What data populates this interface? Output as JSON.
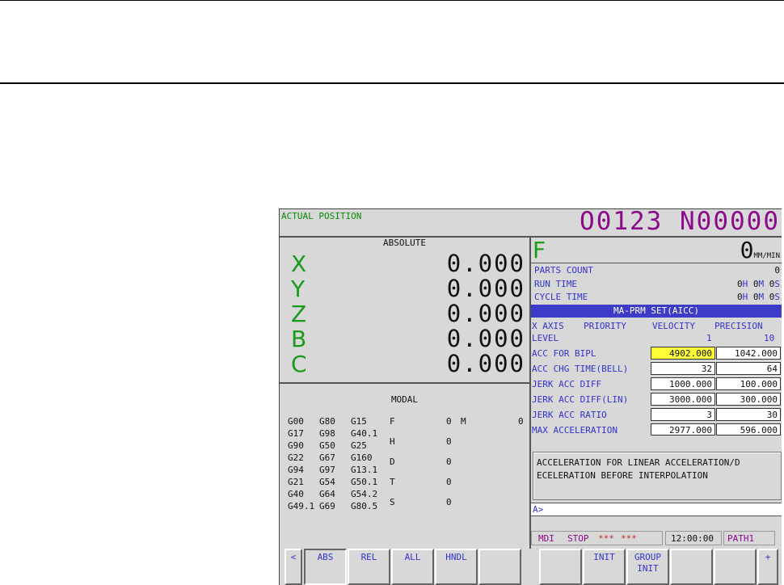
{
  "screen": {
    "title": "ACTUAL POSITION",
    "program": "O0123 N00000"
  },
  "position": {
    "header": "ABSOLUTE",
    "axes": [
      {
        "name": "X",
        "value": "0.000"
      },
      {
        "name": "Y",
        "value": "0.000"
      },
      {
        "name": "Z",
        "value": "0.000"
      },
      {
        "name": "B",
        "value": "0.000"
      },
      {
        "name": "C",
        "value": "0.000"
      }
    ]
  },
  "modal": {
    "header": "MODAL",
    "gcodes": [
      [
        "G00",
        "G80",
        "G15"
      ],
      [
        "G17",
        "G98",
        "G40.1"
      ],
      [
        "G90",
        "G50",
        "G25"
      ],
      [
        "G22",
        "G67",
        "G160"
      ],
      [
        "G94",
        "G97",
        "G13.1"
      ],
      [
        "G21",
        "G54",
        "G50.1"
      ],
      [
        "G40",
        "G64",
        "G54.2"
      ],
      [
        "G49.1",
        "G69",
        "G80.5"
      ]
    ],
    "codes": [
      {
        "label": "F",
        "value": "0"
      },
      {
        "label": "H",
        "value": "0"
      },
      {
        "label": "D",
        "value": "0"
      },
      {
        "label": "T",
        "value": "0"
      },
      {
        "label": "S",
        "value": "0"
      }
    ],
    "m_label": "M",
    "m_value": "0"
  },
  "feed": {
    "label": "F",
    "value": "0",
    "unit": "MM/MIN"
  },
  "counters": {
    "parts_count_label": "PARTS COUNT",
    "parts_count_value": "0",
    "run_time_label": "RUN TIME",
    "cycle_time_label": "CYCLE TIME",
    "time_values": [
      "0",
      "0",
      "0"
    ],
    "time_units": [
      "H",
      "M",
      "S"
    ]
  },
  "params": {
    "title": "MA-PRM SET(AICC)",
    "axis_label": "X AXIS",
    "priority_label": "PRIORITY",
    "velocity_label": "VELOCITY",
    "precision_label": "PRECISION",
    "level_label": "LEVEL",
    "level_velocity": "1",
    "level_precision": "10",
    "rows": [
      {
        "label": "ACC FOR BIPL",
        "velocity": "4902.000",
        "precision": "1042.000"
      },
      {
        "label": "ACC CHG TIME(BELL)",
        "velocity": "32",
        "precision": "64"
      },
      {
        "label": "JERK ACC DIFF",
        "velocity": "1000.000",
        "precision": "100.000"
      },
      {
        "label": "JERK ACC DIFF(LIN)",
        "velocity": "3000.000",
        "precision": "300.000"
      },
      {
        "label": "JERK ACC RATIO",
        "velocity": "3",
        "precision": "30"
      },
      {
        "label": "MAX ACCELERATION",
        "velocity": "2977.000",
        "precision": "596.000"
      }
    ],
    "help_line1": "ACCELERATION FOR LINEAR ACCELERATION/D",
    "help_line2": "ECELERATION BEFORE INTERPOLATION"
  },
  "input": {
    "prompt": "A>"
  },
  "status": {
    "mode": "MDI",
    "state": "STOP",
    "alarm1": "***",
    "alarm2": "***",
    "clock": "12:00:00",
    "path": "PATH1"
  },
  "softkeys": {
    "left_arrow": "<",
    "abs": "ABS",
    "rel": "REL",
    "all": "ALL",
    "hndl": "HNDL",
    "init": "INIT",
    "group_init_1": "GROUP",
    "group_init_2": "INIT",
    "right_arrow": "+"
  },
  "colors": {
    "selected_field": "#ffff3a",
    "title_bar": "#3c3cc8",
    "program_number": "#8a0a8a"
  }
}
